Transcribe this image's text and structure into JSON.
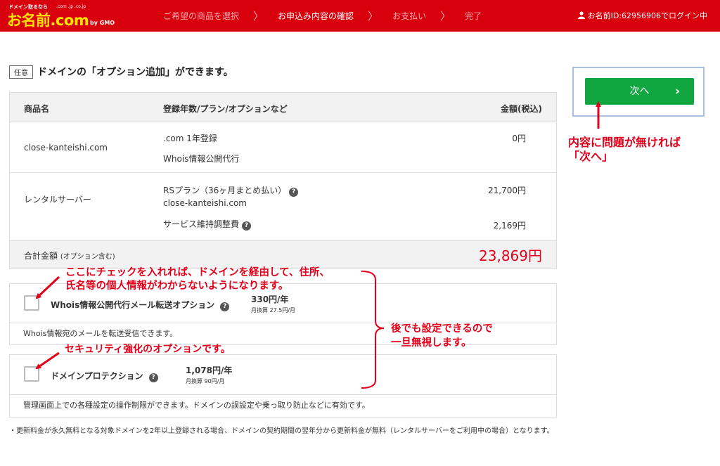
{
  "header": {
    "logo": {
      "tagline": "ドメイン取るなら",
      "name": "お名前.com",
      "tlds": ".com .jp .co.jp",
      "gmo": "by GMO"
    },
    "steps": [
      {
        "label": "ご希望の商品を選択",
        "active": false
      },
      {
        "label": "お申込み内容の確認",
        "active": true
      },
      {
        "label": "お支払い",
        "active": false
      },
      {
        "label": "完了",
        "active": false
      }
    ],
    "login_text": "お名前ID:62956906でログイン中"
  },
  "section": {
    "badge": "任意",
    "title": "ドメインの「オプション追加」ができます。"
  },
  "order_table": {
    "headers": [
      "商品名",
      "登録年数/プラン/オプションなど",
      "金額(税込)"
    ],
    "rows": [
      {
        "product": "close-kanteishi.com",
        "detail1": ".com 1年登録",
        "price1": "0円",
        "detail2": "Whois情報公開代行"
      },
      {
        "product": "レンタルサーバー",
        "detail1": "RSプラン（36ヶ月まとめ払い）",
        "detail1b": "close-kanteishi.com",
        "price1": "21,700円",
        "detail2": "サービス維持調整費",
        "price2": "2,169円"
      }
    ],
    "total_label": "合計金額",
    "total_note": "(オプション含む)",
    "total_value": "23,869円"
  },
  "options": [
    {
      "name": "Whois情報公開代行メール転送オプション",
      "price": "330円/年",
      "monthly": "月換算 27.5円/月",
      "description": "Whois情報宛のメールを転送受信できます。"
    },
    {
      "name": "ドメインプロテクション",
      "price": "1,078円/年",
      "monthly": "月換算 90円/月",
      "description": "管理画面上での各種設定の操作制限ができます。ドメインの誤設定や乗っ取り防止などに有効です。"
    }
  ],
  "footnote": "・更新料金が永久無料となる対象ドメインを2年以上登録される場合、ドメインの契約期間の翌年分から更新料金が無料（レンタルサーバーをご利用中の場合）となります。",
  "next_button": {
    "label": "次へ",
    "chevron": "›"
  },
  "annotations": {
    "next_line1": "内容に問題が無ければ",
    "next_line2": "「次へ」",
    "whois_line1": "ここにチェックを入れれば、ドメインを経由して、住所、",
    "whois_line2": "氏名等の個人情報がわからないようになります。",
    "protection": "セキュリティ強化のオプションです。",
    "ignore_line1": "後でも設定できるので",
    "ignore_line2": "一旦無視します。"
  },
  "colors": {
    "header_red": "#d9000d",
    "accent_red": "#e2001a",
    "button_green": "#11a640",
    "frame_blue": "#a9bfe3"
  }
}
